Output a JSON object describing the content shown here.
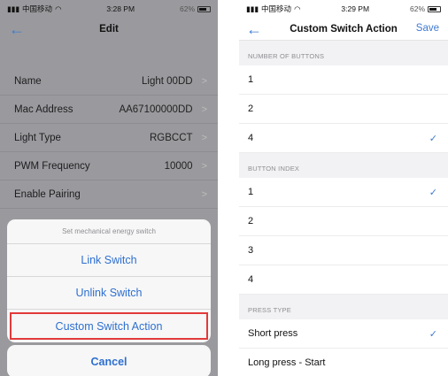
{
  "left_phone": {
    "status": {
      "carrier": "中国移动",
      "time": "3:28 PM",
      "battery": "62%"
    },
    "nav": {
      "title": "Edit"
    },
    "rows": [
      {
        "label": "Name",
        "value": "Light 00DD"
      },
      {
        "label": "Mac Address",
        "value": "AA67100000DD"
      },
      {
        "label": "Light Type",
        "value": "RGBCCT"
      },
      {
        "label": "PWM Frequency",
        "value": "10000"
      },
      {
        "label": "Enable Pairing",
        "value": ""
      }
    ],
    "sheet": {
      "title": "Set mechanical energy switch",
      "options": [
        "Link Switch",
        "Unlink Switch",
        "Custom Switch Action"
      ],
      "cancel": "Cancel"
    }
  },
  "right_phone": {
    "status": {
      "carrier": "中国移动",
      "time": "3:29 PM",
      "battery": "62%"
    },
    "nav": {
      "title": "Custom Switch Action",
      "save": "Save"
    },
    "sections": [
      {
        "header": "NUMBER OF BUTTONS",
        "options": [
          "1",
          "2",
          "4"
        ],
        "selected": 2
      },
      {
        "header": "BUTTON INDEX",
        "options": [
          "1",
          "2",
          "3",
          "4"
        ],
        "selected": 0
      },
      {
        "header": "PRESS TYPE",
        "options": [
          "Short press",
          "Long press - Start"
        ],
        "selected": 0
      }
    ]
  },
  "colors": {
    "accent": "#3f7bd1",
    "highlight": "#e23a3a"
  }
}
